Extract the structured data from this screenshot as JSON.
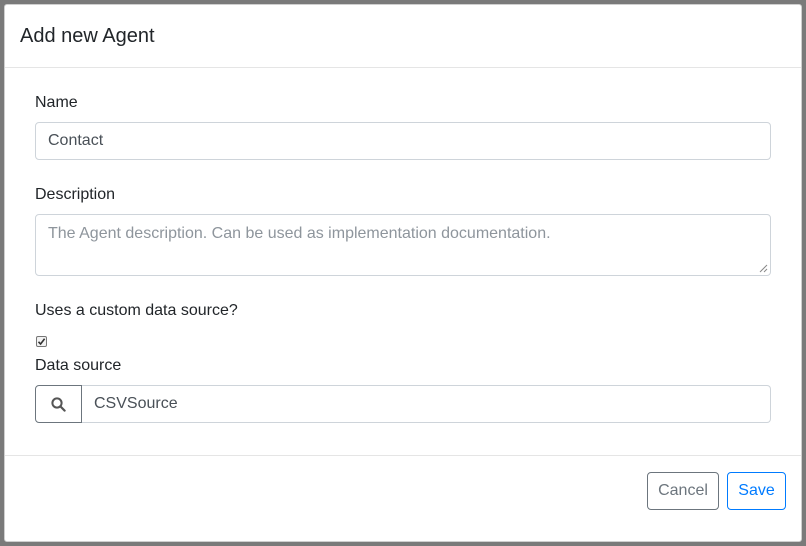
{
  "modal": {
    "title": "Add new Agent"
  },
  "form": {
    "name": {
      "label": "Name",
      "value": "Contact"
    },
    "description": {
      "label": "Description",
      "placeholder": "The Agent description. Can be used as implementation documentation.",
      "value": ""
    },
    "custom_data_source": {
      "label": "Uses a custom data source?",
      "checked": true
    },
    "data_source": {
      "label": "Data source",
      "value": "CSVSource",
      "icon": "search-icon"
    }
  },
  "footer": {
    "cancel_label": "Cancel",
    "save_label": "Save"
  },
  "colors": {
    "primary": "#007bff",
    "secondary": "#6c757d",
    "border": "#ced4da"
  }
}
